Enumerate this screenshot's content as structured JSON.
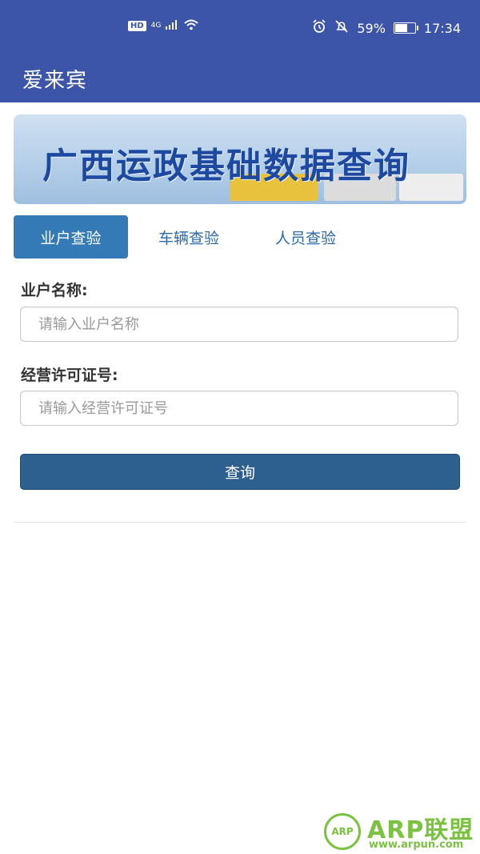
{
  "status_bar": {
    "hd": "HD",
    "network": "4G",
    "battery": "59%",
    "time": "17:34"
  },
  "app_bar": {
    "title": "爱来宾"
  },
  "banner": {
    "title": "广西运政基础数据查询"
  },
  "tabs": [
    {
      "label": "业户查验",
      "active": true
    },
    {
      "label": "车辆查验",
      "active": false
    },
    {
      "label": "人员查验",
      "active": false
    }
  ],
  "form": {
    "owner_name_label": "业户名称:",
    "owner_name_placeholder": "请输入业户名称",
    "license_label": "经营许可证号:",
    "license_placeholder": "请输入经营许可证号",
    "submit_label": "查询"
  },
  "watermark": {
    "badge": "ARP",
    "brand": "ARP联盟",
    "url": "www.arpun.com"
  },
  "colors": {
    "primary": "#3d55a8",
    "tab_active": "#337ab7",
    "button": "#2d5f8f",
    "watermark": "#7cc242"
  }
}
